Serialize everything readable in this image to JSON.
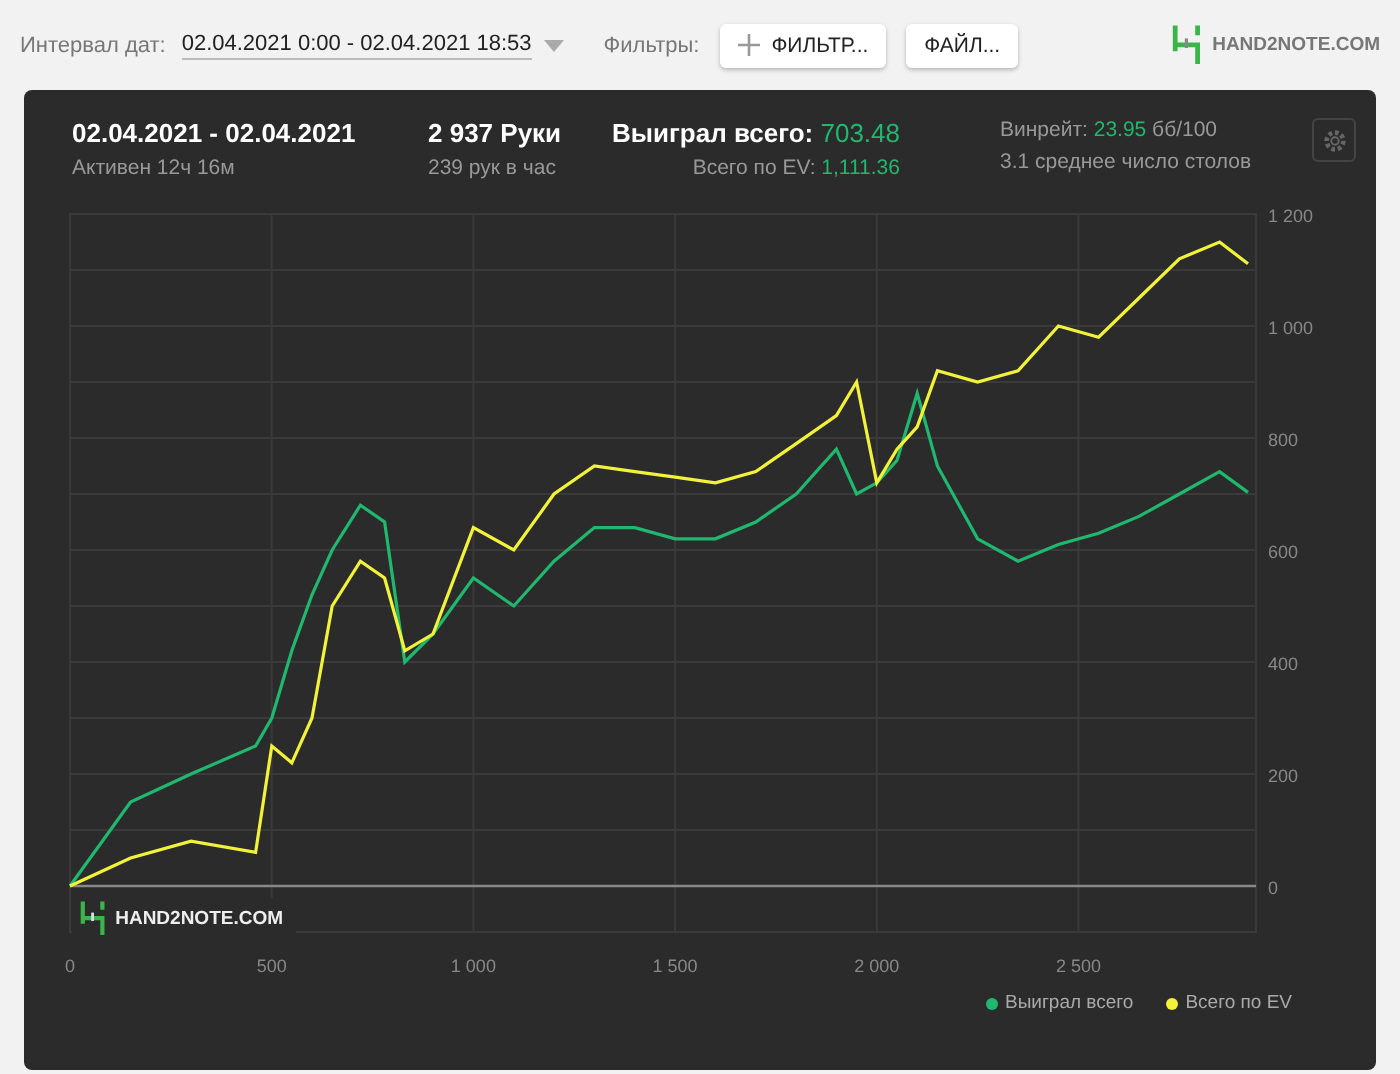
{
  "toolbar": {
    "date_label": "Интервал дат:",
    "date_value": "02.04.2021 0:00 - 02.04.2021 18:53",
    "filters_label": "Фильтры:",
    "buttons": [
      {
        "label": "ФИЛЬТР...",
        "kind": "add"
      },
      {
        "label": "ФАЙЛ...",
        "kind": "plain"
      }
    ],
    "logo": "HAND2NOTE.COM"
  },
  "summary": {
    "period": "02.04.2021 - 02.04.2021",
    "active": "Активен 12ч 16м",
    "hands": "2 937 Руки",
    "hands_rate": "239 рук в час",
    "won_label": "Выиграл всего:",
    "won_value": "703.48",
    "ev_label": "Всего по EV:",
    "ev_value": "1,111.36",
    "winrate_label": "Винрейт:",
    "winrate_value": "23.95",
    "winrate_unit": "бб/100",
    "tables": "3.1 среднее число столов"
  },
  "chart": {
    "watermark": "HAND2NOTE.COM",
    "chart_data": {
      "type": "line",
      "x": [
        0,
        150,
        300,
        460,
        500,
        550,
        600,
        650,
        720,
        780,
        830,
        900,
        1000,
        1100,
        1200,
        1300,
        1400,
        1500,
        1600,
        1700,
        1800,
        1900,
        1950,
        2000,
        2050,
        2100,
        2150,
        2250,
        2350,
        2450,
        2550,
        2650,
        2750,
        2850,
        2920
      ],
      "series": [
        {
          "name": "Выиграл всего",
          "color": "#1fb86e",
          "values": [
            0,
            150,
            200,
            250,
            300,
            420,
            520,
            600,
            680,
            650,
            400,
            450,
            550,
            500,
            580,
            640,
            640,
            620,
            620,
            650,
            700,
            780,
            700,
            720,
            760,
            880,
            750,
            620,
            580,
            610,
            630,
            660,
            700,
            740,
            703
          ]
        },
        {
          "name": "Всего по EV",
          "color": "#f2f23a",
          "values": [
            0,
            50,
            80,
            60,
            250,
            220,
            300,
            500,
            580,
            550,
            420,
            450,
            640,
            600,
            700,
            750,
            740,
            730,
            720,
            740,
            790,
            840,
            900,
            720,
            780,
            820,
            920,
            900,
            920,
            1000,
            980,
            1050,
            1120,
            1150,
            1111
          ]
        }
      ],
      "xlim": [
        0,
        2940
      ],
      "grid": true,
      "ylim": [
        -82,
        1200
      ],
      "xticks": [
        0,
        500,
        {
          "value": 1000,
          "label": "1 000"
        },
        {
          "value": 1500,
          "label": "1 500"
        },
        {
          "value": 2000,
          "label": "2 000"
        },
        {
          "value": 2500,
          "label": "2 500"
        }
      ],
      "yticks": [
        0,
        200,
        400,
        600,
        800,
        {
          "value": 1000,
          "label": "1 000"
        },
        {
          "value": 1200,
          "label": "1 200"
        }
      ]
    }
  }
}
